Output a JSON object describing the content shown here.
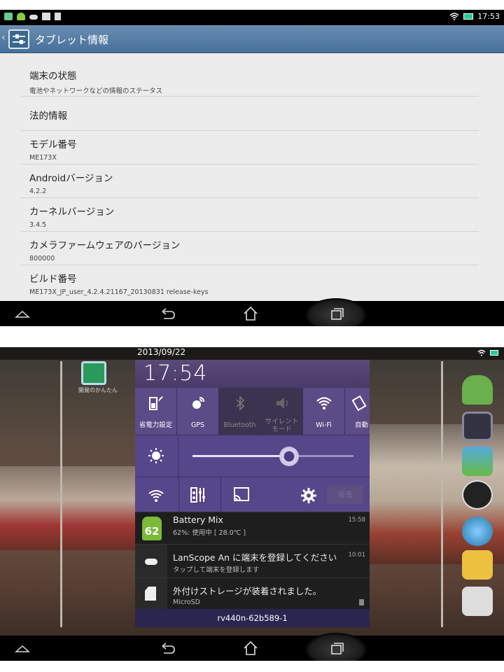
{
  "screen1": {
    "status_time": "17:53",
    "title": "タブレット情報",
    "items": [
      {
        "title": "端末の状態",
        "sub": "電池やネットワークなどの情報のステータス"
      },
      {
        "title": "法的情報",
        "sub": ""
      },
      {
        "title": "モデル番号",
        "sub": "ME173X"
      },
      {
        "title": "Androidバージョン",
        "sub": "4.2.2"
      },
      {
        "title": "カーネルバージョン",
        "sub": "3.4.5"
      },
      {
        "title": "カメラファームウェアのバージョン",
        "sub": "800000"
      },
      {
        "title": "ビルド番号",
        "sub": "ME173X_JP_user_4.2.4.21167_20130831 release-keys"
      }
    ]
  },
  "screen2": {
    "date": "2013/09/22",
    "clock": "17:54",
    "quick_settings": [
      {
        "label": "省電力設定",
        "icon": "power-saver-icon",
        "active": true
      },
      {
        "label": "GPS",
        "icon": "gps-icon",
        "active": true
      },
      {
        "label": "Bluetooth",
        "icon": "bluetooth-icon",
        "active": false
      },
      {
        "label": "サイレント\nモード",
        "icon": "silent-icon",
        "active": false
      },
      {
        "label": "Wi-Fi",
        "icon": "wifi-icon",
        "active": true
      },
      {
        "label": "自動",
        "icon": "auto-rotate-icon",
        "active": true
      }
    ],
    "brightness": 0.6,
    "clear_label": "消去",
    "notifications": [
      {
        "title": "Battery Mix",
        "sub": "62%: 使用中 [ 28.0℃ ]",
        "time": "15:58",
        "badge": "62"
      },
      {
        "title": "LanScope An に端末を登録してください",
        "sub": "タップして端末を登録します",
        "time": "10:01"
      },
      {
        "title": "外付けストレージが装着されました。",
        "sub": "MicroSD",
        "time": ""
      }
    ],
    "footer": "rv440n-62b589-1",
    "home_app_label": "開発のかんたん"
  },
  "colors": {
    "accent": "#56468a",
    "appbar": "#4f779f"
  }
}
